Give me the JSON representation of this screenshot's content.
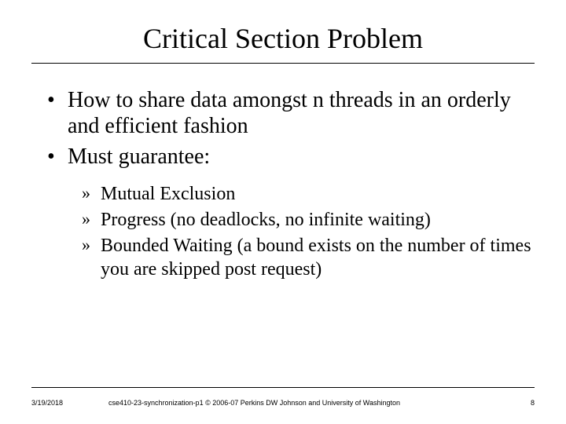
{
  "title": "Critical Section Problem",
  "bullets": [
    {
      "text": "How to share data amongst n threads in an orderly and efficient fashion"
    },
    {
      "text": "Must guarantee:",
      "sub": [
        "Mutual Exclusion",
        "Progress (no deadlocks, no infinite waiting)",
        "Bounded Waiting (a bound exists on the number of times you are skipped post request)"
      ]
    }
  ],
  "footer": {
    "date": "3/19/2018",
    "center": "cse410-23-synchronization-p1 © 2006-07 Perkins DW Johnson and University of Washington",
    "page": "8"
  }
}
